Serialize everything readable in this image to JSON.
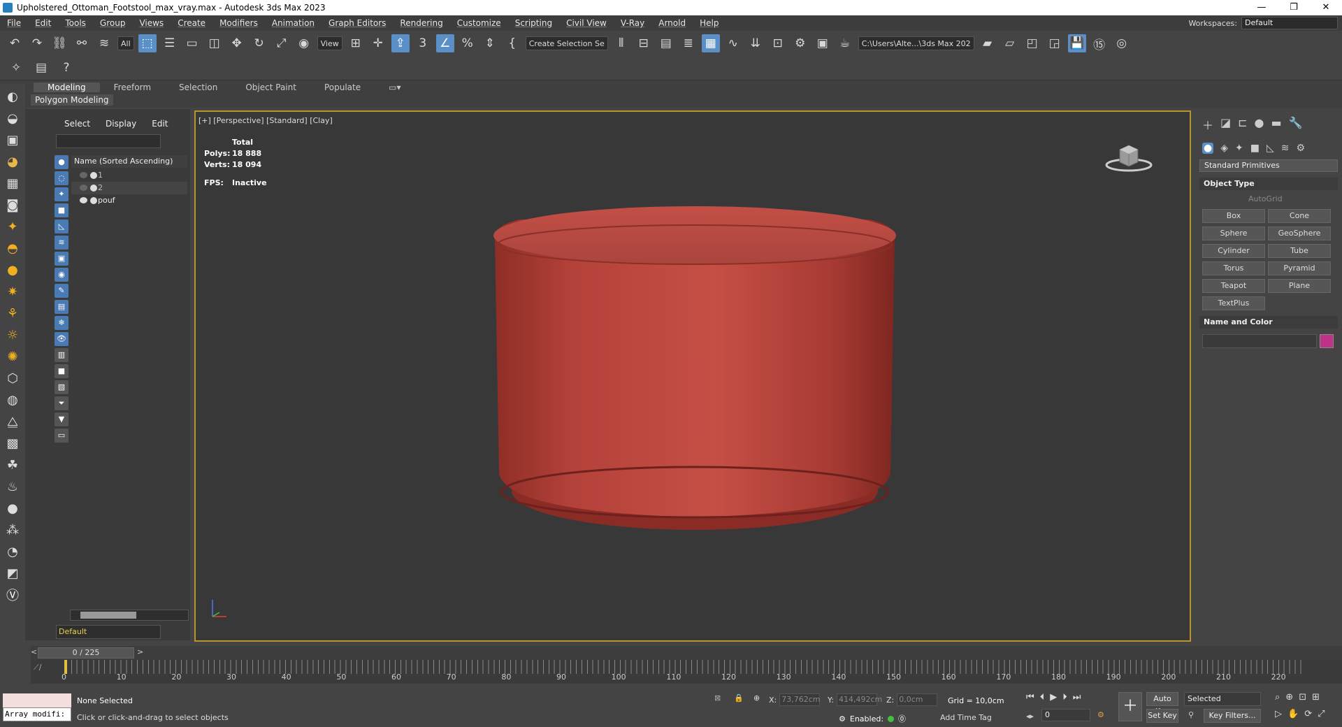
{
  "window": {
    "title": "Upholstered_Ottoman_Footstool_max_vray.max - Autodesk 3ds Max 2023",
    "minimize": "—",
    "maximize": "❐",
    "close": "✕"
  },
  "menu": {
    "items": [
      "File",
      "Edit",
      "Tools",
      "Group",
      "Views",
      "Create",
      "Modifiers",
      "Animation",
      "Graph Editors",
      "Rendering",
      "Customize",
      "Scripting",
      "Civil View",
      "V-Ray",
      "Arnold",
      "Help"
    ],
    "workspaces_label": "Workspaces:",
    "workspace_value": "Default"
  },
  "toolbar": {
    "filter": "All",
    "refcoord": "View",
    "selection_set": "Create Selection Se",
    "path": "C:\\Users\\Alte...\\3ds Max 202"
  },
  "ribbon": {
    "tabs": [
      "Modeling",
      "Freeform",
      "Selection",
      "Object Paint",
      "Populate"
    ],
    "active_sub": "Polygon Modeling"
  },
  "scene_explorer": {
    "tabs": [
      "Select",
      "Display",
      "Edit"
    ],
    "column_header": "Name (Sorted Ascending)",
    "rows": [
      "1",
      "2",
      "pouf"
    ],
    "layer": "Default"
  },
  "viewport": {
    "label": "[+] [Perspective] [Standard] [Clay]",
    "stats_total": "Total",
    "polys_label": "Polys:",
    "polys_value": "18 888",
    "verts_label": "Verts:",
    "verts_value": "18 094",
    "fps_label": "FPS:",
    "fps_value": "Inactive",
    "object_color": "#b8453b"
  },
  "command_panel": {
    "category": "Standard Primitives",
    "object_type_title": "Object Type",
    "autogrid": "AutoGrid",
    "primitives": [
      "Box",
      "Cone",
      "Sphere",
      "GeoSphere",
      "Cylinder",
      "Tube",
      "Torus",
      "Pyramid",
      "Teapot",
      "Plane",
      "TextPlus"
    ],
    "name_color_title": "Name and Color",
    "swatch_color": "#c0318a"
  },
  "timeline": {
    "frame_display": "0 / 225",
    "prev": "<",
    "next": ">",
    "ticks": [
      "0",
      "10",
      "20",
      "30",
      "40",
      "50",
      "60",
      "70",
      "80",
      "90",
      "100",
      "110",
      "120",
      "130",
      "140",
      "150",
      "160",
      "170",
      "180",
      "190",
      "200",
      "210",
      "220"
    ]
  },
  "status": {
    "maxscript": "Array modifi:",
    "selection": "None Selected",
    "prompt": "Click or click-and-drag to select objects",
    "x_label": "X:",
    "x_value": "73,762cm",
    "y_label": "Y:",
    "y_value": "414,492cm",
    "z_label": "Z:",
    "z_value": "0,0cm",
    "grid": "Grid = 10,0cm",
    "enabled": "Enabled:",
    "add_time_tag": "Add Time Tag",
    "auto_key": "Auto Key",
    "set_key": "Set Key",
    "selected": "Selected",
    "key_filters": "Key Filters...",
    "current_frame": "0"
  }
}
